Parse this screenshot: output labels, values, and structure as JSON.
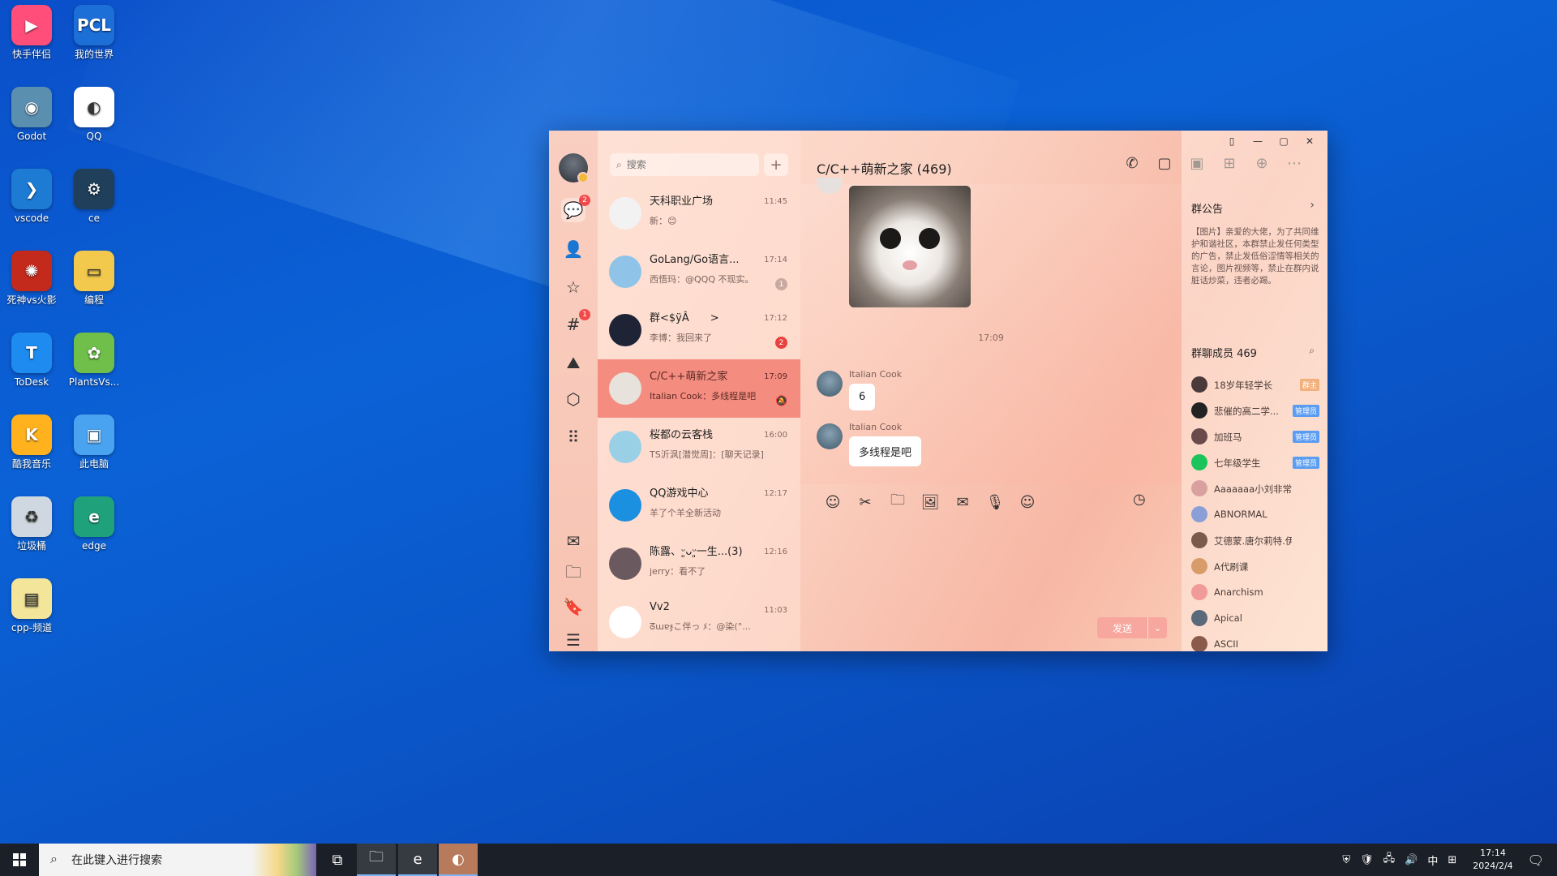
{
  "desktop": {
    "icons": [
      {
        "label": "快手伴侣",
        "icon": "kuaishou-icon",
        "color": "#ff4e7a",
        "glyph": "▶"
      },
      {
        "label": "我的世界",
        "icon": "pcl-icon",
        "color": "#1d6fd8",
        "glyph": "PCL"
      },
      {
        "label": "Godot",
        "icon": "godot-icon",
        "color": "#5b8fb0",
        "glyph": "◉"
      },
      {
        "label": "QQ",
        "icon": "qq-icon",
        "color": "#ffffff",
        "glyph": "◐"
      },
      {
        "label": "vscode",
        "icon": "vscode-icon",
        "color": "#1d7bd4",
        "glyph": "❯"
      },
      {
        "label": "ce",
        "icon": "cheat-engine-icon",
        "color": "#1f3f5a",
        "glyph": "⚙"
      },
      {
        "label": "死神vs火影",
        "icon": "game-icon",
        "color": "#c42a1c",
        "glyph": "✺"
      },
      {
        "label": "编程",
        "icon": "folder-icon",
        "color": "#f2c94c",
        "glyph": "▭"
      },
      {
        "label": "ToDesk",
        "icon": "todesk-icon",
        "color": "#1e8bf0",
        "glyph": "T"
      },
      {
        "label": "PlantsVs...",
        "icon": "plants-icon",
        "color": "#6fbf4a",
        "glyph": "✿"
      },
      {
        "label": "酷我音乐",
        "icon": "kuwo-icon",
        "color": "#ffb21d",
        "glyph": "K"
      },
      {
        "label": "此电脑",
        "icon": "this-pc-icon",
        "color": "#4aa3f0",
        "glyph": "▣"
      },
      {
        "label": "垃圾桶",
        "icon": "recycle-bin-icon",
        "color": "#cfd8e0",
        "glyph": "♻"
      },
      {
        "label": "edge",
        "icon": "edge-icon",
        "color": "#1fa27c",
        "glyph": "e"
      },
      {
        "label": "cpp-频道",
        "icon": "document-icon",
        "color": "#f3e59a",
        "glyph": "▤"
      }
    ]
  },
  "qq": {
    "nav": {
      "items": [
        {
          "name": "messages",
          "icon": "chat-bubble-icon",
          "glyph": "💬",
          "badge": "2"
        },
        {
          "name": "contacts",
          "icon": "person-icon",
          "glyph": "👤",
          "badge": ""
        },
        {
          "name": "favorites",
          "icon": "star-icon",
          "glyph": "☆",
          "badge": ""
        },
        {
          "name": "channels",
          "icon": "hashtag-icon",
          "glyph": "#",
          "badge": "1"
        },
        {
          "name": "games",
          "icon": "map-icon",
          "glyph": "⛰",
          "badge": ""
        },
        {
          "name": "discover",
          "icon": "cube-icon",
          "glyph": "⬡",
          "badge": ""
        },
        {
          "name": "apps",
          "icon": "grid-dots-icon",
          "glyph": "⠿",
          "badge": ""
        },
        {
          "name": "mail",
          "icon": "mail-icon",
          "glyph": "✉",
          "badge": ""
        },
        {
          "name": "files",
          "icon": "folder-icon",
          "glyph": "🗀",
          "badge": ""
        },
        {
          "name": "collections",
          "icon": "bookmark-icon",
          "glyph": "🔖",
          "badge": ""
        },
        {
          "name": "menu",
          "icon": "hamburger-menu-icon",
          "glyph": "☰",
          "badge": ""
        }
      ]
    },
    "search": {
      "placeholder": "搜索",
      "add_label": "+"
    },
    "conversations": [
      {
        "name": "天科职业广场",
        "time": "11:45",
        "preview": "新：😊",
        "badge": "",
        "muted": false,
        "avatar_color": "#f2f2f2"
      },
      {
        "name": "GoLang/Go语言...",
        "time": "17:14",
        "preview": "西悟玛：@QQQ 不现实。",
        "badge": "1",
        "badge_grey": true,
        "muted": false,
        "avatar_color": "#8fc3e8"
      },
      {
        "name": "群<$ÿÂ　　>",
        "time": "17:12",
        "preview": "李博：我回来了",
        "badge": "2",
        "muted": false,
        "avatar_color": "#1e2435"
      },
      {
        "name": "C/C++萌新之家",
        "time": "17:09",
        "preview": "Italian Cook：多线程是吧",
        "badge": "",
        "muted": true,
        "active": true,
        "avatar_color": "#e8e2dc"
      },
      {
        "name": "桜都の云客栈",
        "time": "16:00",
        "preview": "TS沂沨[潜觉周]：[聊天记录]",
        "badge": "",
        "muted": false,
        "avatar_color": "#9ad0e6"
      },
      {
        "name": "QQ游戏中心",
        "time": "12:17",
        "preview": "羊了个羊全新活动",
        "badge": "",
        "muted": false,
        "avatar_color": "#1b8fe0"
      },
      {
        "name": "陈露、ᵕ͈ᴗᵕ͈一生...(3)",
        "time": "12:16",
        "preview": "jerry：看不了",
        "badge": "",
        "muted": false,
        "avatar_color": "#6a5a60"
      },
      {
        "name": "Vv2",
        "time": "11:03",
        "preview": "ᘔɯɐჯこ伴っ ﾒ：@染(°...",
        "badge": "",
        "muted": false,
        "avatar_color": "#ffffff"
      }
    ],
    "chat": {
      "title": "C/C++萌新之家 (469)",
      "header_icons": [
        {
          "name": "voice-call-icon",
          "glyph": "✆"
        },
        {
          "name": "video-call-icon",
          "glyph": "▢"
        },
        {
          "name": "screen-share-icon",
          "glyph": "▣"
        },
        {
          "name": "apps-icon",
          "glyph": "⊞"
        },
        {
          "name": "add-member-icon",
          "glyph": "⊕"
        },
        {
          "name": "more-icon",
          "glyph": "⋯"
        }
      ],
      "time_separator": "17:09",
      "messages": [
        {
          "sender": "Italian Cook",
          "text": "6"
        },
        {
          "sender": "Italian Cook",
          "text": "多线程是吧"
        }
      ],
      "toolbar": [
        {
          "name": "emoji-icon",
          "glyph": "☺"
        },
        {
          "name": "scissors-icon",
          "glyph": "✂"
        },
        {
          "name": "folder-icon",
          "glyph": "🗀"
        },
        {
          "name": "image-icon",
          "glyph": "🖼"
        },
        {
          "name": "red-envelope-icon",
          "glyph": "✉"
        },
        {
          "name": "microphone-icon",
          "glyph": "🎙"
        },
        {
          "name": "robot-icon",
          "glyph": "☺"
        }
      ],
      "history_icon": "clock-icon",
      "send_label": "发送",
      "send_dropdown": "⌄"
    },
    "sidebar": {
      "notice_title": "群公告",
      "notice_text": "【图片】亲爱的大佬，为了共同维护和谐社区，本群禁止发任何类型的广告，禁止发低俗涩情等相关的言论，图片视频等，禁止在群内说脏话炒菜，违者必踢。",
      "members_title": "群聊成员 469",
      "members": [
        {
          "name": "18岁年轻学长",
          "role": "群主",
          "role_color": "#f4b07a",
          "avatar_color": "#4b3a3a"
        },
        {
          "name": "悲催的高二学...",
          "role": "管理员",
          "role_color": "#5b9df0",
          "avatar_color": "#222"
        },
        {
          "name": "加班马",
          "role": "管理员",
          "role_color": "#5b9df0",
          "avatar_color": "#6a4a4a"
        },
        {
          "name": "七年级学生",
          "role": "管理员",
          "role_color": "#5b9df0",
          "avatar_color": "#1ac45a"
        },
        {
          "name": "Aaaaaaa小刘非常lazy",
          "role": "",
          "avatar_color": "#d9a0a0"
        },
        {
          "name": "ABNORMAL",
          "role": "",
          "avatar_color": "#8a9fd8"
        },
        {
          "name": "艾德蒙.唐尔莉特.伊吴...",
          "role": "",
          "avatar_color": "#7b5a4a"
        },
        {
          "name": "A代刷课",
          "role": "",
          "avatar_color": "#d89b6a"
        },
        {
          "name": "Anarchism",
          "role": "",
          "avatar_color": "#f09a9a"
        },
        {
          "name": "Apical",
          "role": "",
          "avatar_color": "#5a6a7a"
        },
        {
          "name": "ASCII",
          "role": "",
          "avatar_color": "#8a5a4a"
        }
      ]
    },
    "window_controls": [
      {
        "name": "pin-window-icon",
        "glyph": "▯"
      },
      {
        "name": "minimize-icon",
        "glyph": "—"
      },
      {
        "name": "maximize-icon",
        "glyph": "▢"
      },
      {
        "name": "close-icon",
        "glyph": "✕"
      }
    ]
  },
  "taskbar": {
    "search_placeholder": "在此键入进行搜索",
    "apps": [
      {
        "name": "task-view-icon",
        "glyph": "⧉"
      },
      {
        "name": "file-explorer-icon",
        "glyph": "🗀"
      },
      {
        "name": "edge-icon",
        "glyph": "e"
      },
      {
        "name": "qq-icon",
        "glyph": "◐"
      }
    ],
    "tray": {
      "ime": "中",
      "time": "17:14",
      "date": "2024/2/4"
    }
  }
}
